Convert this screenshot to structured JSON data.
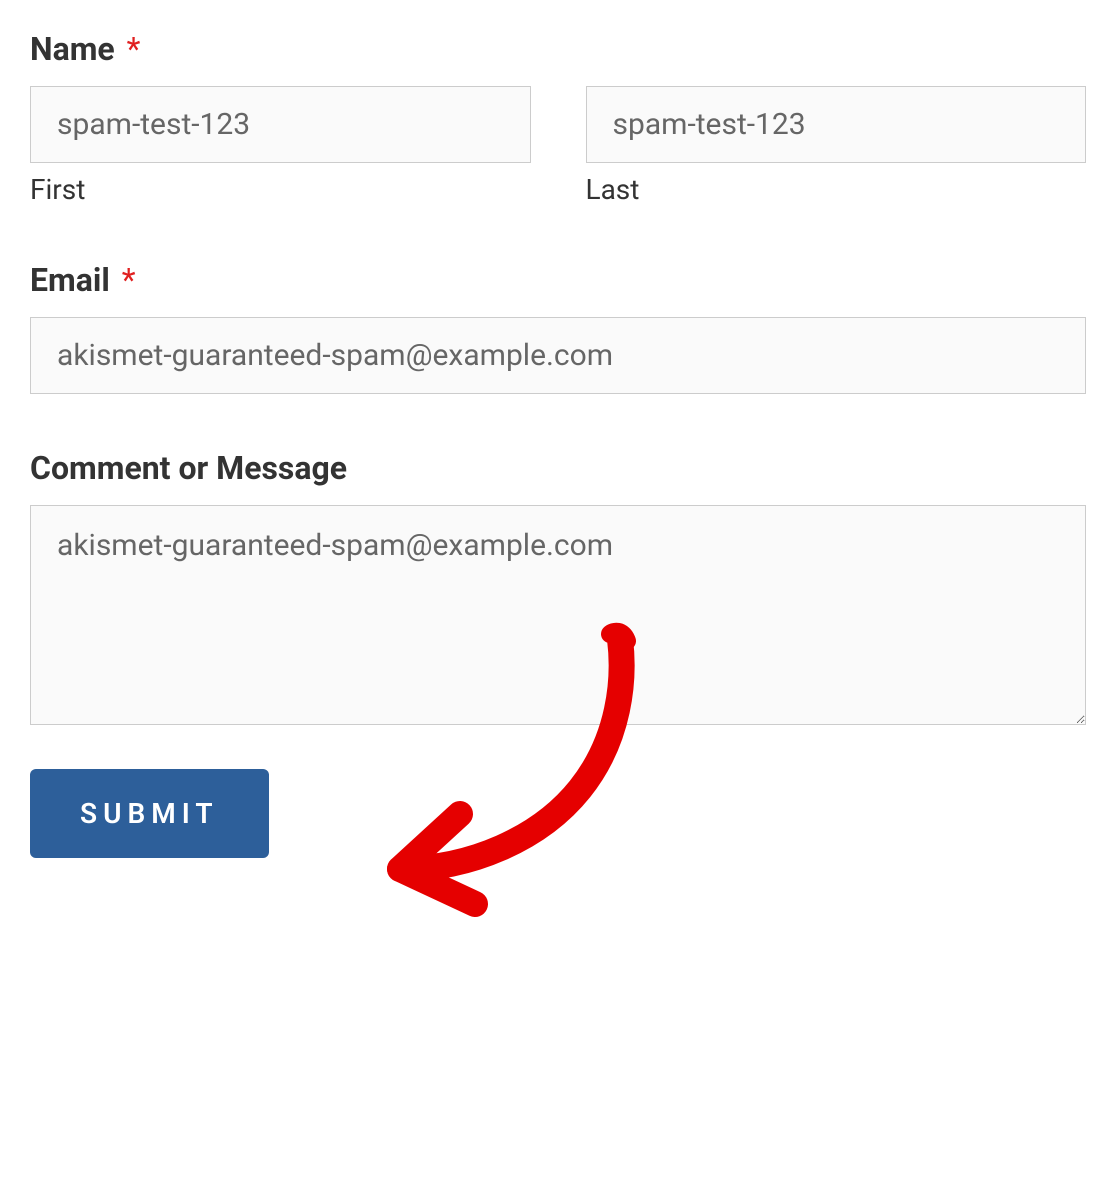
{
  "form": {
    "name": {
      "label": "Name",
      "required": true,
      "required_marker": "*",
      "first": {
        "value": "spam-test-123",
        "sublabel": "First"
      },
      "last": {
        "value": "spam-test-123",
        "sublabel": "Last"
      }
    },
    "email": {
      "label": "Email",
      "required": true,
      "required_marker": "*",
      "value": "akismet-guaranteed-spam@example.com"
    },
    "comment": {
      "label": "Comment or Message",
      "required": false,
      "value": "akismet-guaranteed-spam@example.com"
    },
    "submit": {
      "label": "SUBMIT"
    }
  },
  "annotation": {
    "arrow_color": "#e50000"
  }
}
